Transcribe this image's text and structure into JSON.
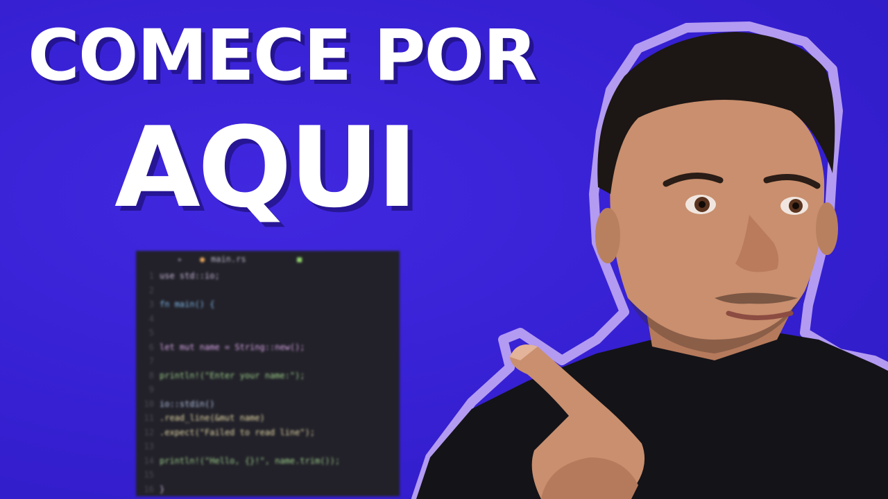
{
  "headline": {
    "line1": "COMECE POR",
    "line2": "AQUI"
  },
  "code_editor": {
    "tab_label": "main.rs",
    "lines": [
      {
        "n": "1",
        "text": "use std::io;",
        "color": "#c9b9d9"
      },
      {
        "n": "2",
        "text": "",
        "color": "#c9b9d9"
      },
      {
        "n": "3",
        "text": "fn main() {",
        "color": "#7fb7e6"
      },
      {
        "n": "4",
        "text": "",
        "color": "#c9b9d9"
      },
      {
        "n": "5",
        "text": "",
        "color": "#c9b9d9"
      },
      {
        "n": "6",
        "text": "let mut name = String::new();",
        "color": "#d7a6e6"
      },
      {
        "n": "7",
        "text": "",
        "color": "#c9b9d9"
      },
      {
        "n": "8",
        "text": "println!(\"Enter your name:\");",
        "color": "#9ed18a"
      },
      {
        "n": "9",
        "text": "",
        "color": "#c9b9d9"
      },
      {
        "n": "10",
        "text": "io::stdin()",
        "color": "#b6c6e6"
      },
      {
        "n": "11",
        "text": "    .read_line(&mut name)",
        "color": "#e6d9a6"
      },
      {
        "n": "12",
        "text": "    .expect(\"Failed to read line\");",
        "color": "#e6d9a6"
      },
      {
        "n": "13",
        "text": "",
        "color": "#c9b9d9"
      },
      {
        "n": "14",
        "text": "println!(\"Hello, {}!\", name.trim());",
        "color": "#9ed18a"
      },
      {
        "n": "15",
        "text": "",
        "color": "#c9b9d9"
      },
      {
        "n": "16",
        "text": "}",
        "color": "#c9b9d9"
      }
    ]
  },
  "colors": {
    "background": "#3a22d6",
    "outline": "#b39bf2",
    "shirt": "#141318",
    "skin": "#c98f6e",
    "hair": "#1c1614"
  }
}
